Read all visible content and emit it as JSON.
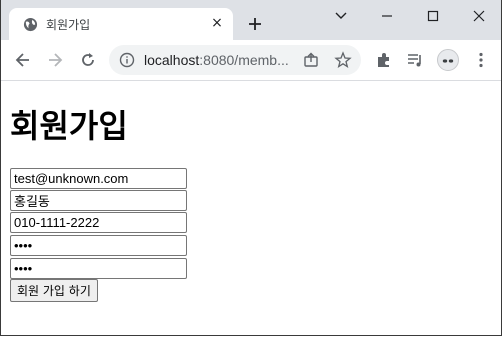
{
  "browser": {
    "tab": {
      "title": "회원가입",
      "favicon": "globe-icon",
      "close": "×"
    },
    "new_tab_icon": "plus-icon",
    "window_controls": [
      "chevron-down-icon",
      "minimize-icon",
      "maximize-icon",
      "close-icon"
    ],
    "toolbar": {
      "back": "back-arrow-icon",
      "forward": "forward-arrow-icon",
      "reload": "reload-icon",
      "url_host": "localhost",
      "url_rest": ":8080/memb...",
      "site_info": "info-icon",
      "share": "share-icon",
      "bookmark": "star-icon",
      "extensions": "puzzle-icon",
      "reading_list": "reading-list-icon",
      "profile": "avatar-icon",
      "menu": "kebab-menu-icon"
    }
  },
  "form": {
    "heading": "회원가입",
    "email": "test@unknown.com",
    "name": "홍길동",
    "phone": "010-1111-2222",
    "password": "1234",
    "password_confirm": "1234",
    "submit_label": "회원 가입 하기"
  },
  "colors": {
    "tabstrip_bg": "#dee1e6",
    "omnibox_bg": "#f1f3f4",
    "page_bg": "#ffffff"
  }
}
